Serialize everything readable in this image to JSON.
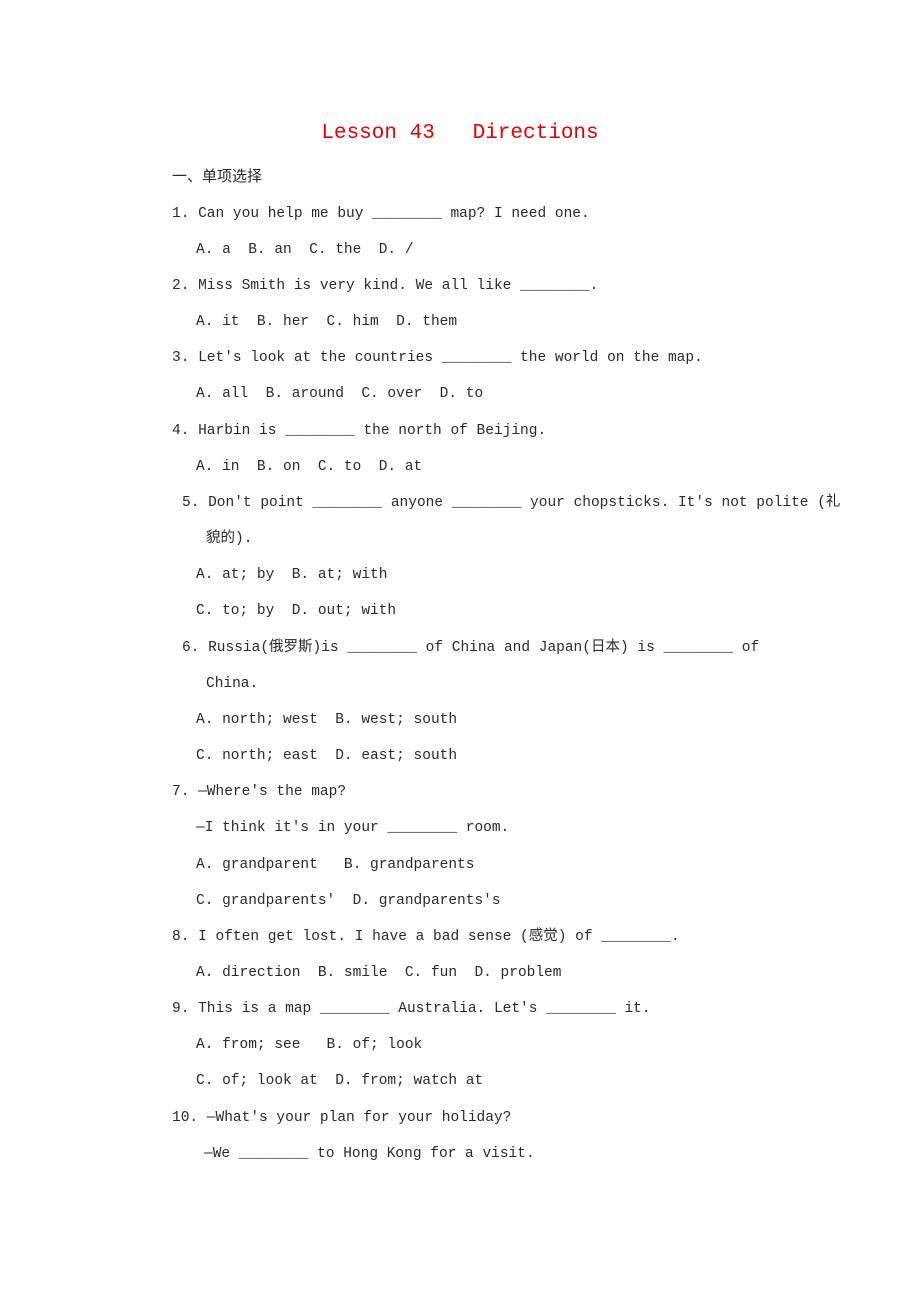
{
  "document": {
    "title": "Lesson 43   Directions",
    "section_heading": "一、单项选择",
    "questions": [
      {
        "number": "1.",
        "stem": "1. Can you help me buy ________ map? I need one.",
        "options": [
          "A. a  B. an  C. the  D. /"
        ]
      },
      {
        "number": "2.",
        "stem": "2. Miss Smith is very kind. We all like ________.",
        "options": [
          "A. it  B. her  C. him  D. them"
        ]
      },
      {
        "number": "3.",
        "stem": "3. Let's look at the countries ________ the world on the map.",
        "options": [
          "A. all  B. around  C. over  D. to"
        ]
      },
      {
        "number": "4.",
        "stem": "4. Harbin is ________ the north of Beijing.",
        "options": [
          "A. in  B. on  C. to  D. at"
        ]
      },
      {
        "number": "5.",
        "stem": "5. Don't point ________ anyone ________ your chopsticks. It's not polite (礼",
        "stem_cont": "貌的).",
        "options": [
          "A. at; by  B. at; with",
          "C. to; by  D. out; with"
        ]
      },
      {
        "number": "6.",
        "stem": "6. Russia(俄罗斯)is ________ of China and Japan(日本) is ________ of",
        "stem_cont": "China.",
        "options": [
          "A. north; west  B. west; south",
          "C. north; east  D. east; south"
        ]
      },
      {
        "number": "7.",
        "stem": "7. —Where's the map?",
        "stem_cont": "—I think it's in your ________ room.",
        "options": [
          "A. grandparent   B. grandparents",
          "C. grandparents'  D. grandparents's"
        ]
      },
      {
        "number": "8.",
        "stem": "8. I often get lost. I have a bad sense (感觉) of ________.",
        "options": [
          "A. direction  B. smile  C. fun  D. problem"
        ]
      },
      {
        "number": "9.",
        "stem": "9. This is a map ________ Australia. Let's ________ it.",
        "options": [
          "A. from; see   B. of; look",
          "C. of; look at  D. from; watch at"
        ]
      },
      {
        "number": "10.",
        "stem": "10. —What's your plan for your holiday?",
        "stem_cont": "—We ________ to Hong Kong for a visit.",
        "options": []
      }
    ]
  }
}
